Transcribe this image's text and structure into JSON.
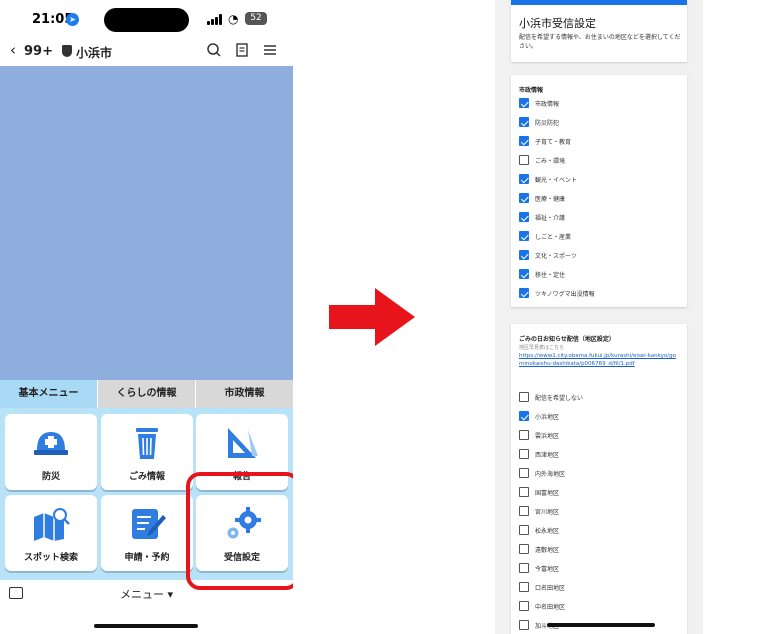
{
  "left_phone": {
    "status": {
      "time": "21:05",
      "battery": "52"
    },
    "nav": {
      "back_count": "99+",
      "city": "小浜市"
    },
    "tabs": [
      {
        "label": "基本メニュー",
        "active": true
      },
      {
        "label": "くらしの情報",
        "active": false
      },
      {
        "label": "市政情報",
        "active": false
      }
    ],
    "tiles": [
      {
        "label": "防災",
        "icon": "helmet-icon"
      },
      {
        "label": "ごみ情報",
        "icon": "trash-icon"
      },
      {
        "label": "報告",
        "icon": "triangle-ruler-icon"
      },
      {
        "label": "スポット検索",
        "icon": "map-search-icon"
      },
      {
        "label": "申請・予約",
        "icon": "form-pen-icon"
      },
      {
        "label": "受信設定",
        "icon": "gears-icon"
      }
    ],
    "bottom": {
      "menu_label": "メニュー ▾"
    },
    "colors": {
      "map": "#8eaedd",
      "tab_active": "#a8d9f5",
      "grid_bg": "#b7e2f8",
      "highlight": "#e8141c",
      "icon_blue": "#2f7de1"
    }
  },
  "right_phone": {
    "title": "小浜市受信設定",
    "description": "配信を希望する情報や、お住まいの地区などを選択してください。",
    "city_info": {
      "heading": "市政情報",
      "items": [
        {
          "label": "市政情報",
          "checked": true
        },
        {
          "label": "防災防犯",
          "checked": true
        },
        {
          "label": "子育て・教育",
          "checked": true
        },
        {
          "label": "ごみ・環境",
          "checked": false
        },
        {
          "label": "観光・イベント",
          "checked": true
        },
        {
          "label": "医療・健康",
          "checked": true
        },
        {
          "label": "福祉・介護",
          "checked": true
        },
        {
          "label": "しごと・産業",
          "checked": true
        },
        {
          "label": "文化・スポーツ",
          "checked": true
        },
        {
          "label": "移住・定住",
          "checked": true
        },
        {
          "label": "ツキノワグマ出没情報",
          "checked": true
        }
      ]
    },
    "garbage": {
      "heading": "ごみの日お知らせ配信（地区設定）",
      "note": "地区早見表はこちら",
      "link": "https://www1.city.obama.fukui.jp/kurashi/eisei-kankyo/gominokaishu-dashikata/p006769_d/fil/1.pdf",
      "items": [
        {
          "label": "配信を希望しない",
          "checked": false
        },
        {
          "label": "小浜地区",
          "checked": true
        },
        {
          "label": "雲浜地区",
          "checked": false
        },
        {
          "label": "西津地区",
          "checked": false
        },
        {
          "label": "内外海地区",
          "checked": false
        },
        {
          "label": "国富地区",
          "checked": false
        },
        {
          "label": "宮川地区",
          "checked": false
        },
        {
          "label": "松永地区",
          "checked": false
        },
        {
          "label": "遠敷地区",
          "checked": false
        },
        {
          "label": "今富地区",
          "checked": false
        },
        {
          "label": "口名田地区",
          "checked": false
        },
        {
          "label": "中名田地区",
          "checked": false
        },
        {
          "label": "加斗地区",
          "checked": false
        }
      ]
    },
    "colors": {
      "accent": "#1a73e8",
      "background": "#f1f1f1"
    }
  },
  "arrow": {
    "color": "#e8141c"
  }
}
